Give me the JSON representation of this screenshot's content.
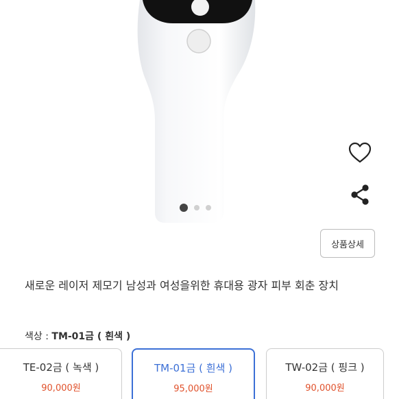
{
  "product": {
    "title": "새로운 레이저 제모기 남성과 여성을위한 휴대용 광자 피부 회춘 장치",
    "detail_button": "상품상세",
    "gallery": {
      "slide_count": 3,
      "active_slide": 1
    }
  },
  "selection": {
    "label": "색상 : ",
    "value": "TM-01금 ( 흰색 )"
  },
  "options": [
    {
      "name": "TE-02금 ( 녹색 )",
      "price": "90,000원",
      "selected": false
    },
    {
      "name": "TM-01금 ( 흰색 )",
      "price": "95,000원",
      "selected": true
    },
    {
      "name": "TW-02금 ( 핑크 )",
      "price": "90,000원",
      "selected": false
    }
  ],
  "icons": {
    "like": "heart-outline-icon",
    "share": "share-icon"
  },
  "colors": {
    "accent": "#3b6fd6",
    "price": "#e0512b"
  }
}
